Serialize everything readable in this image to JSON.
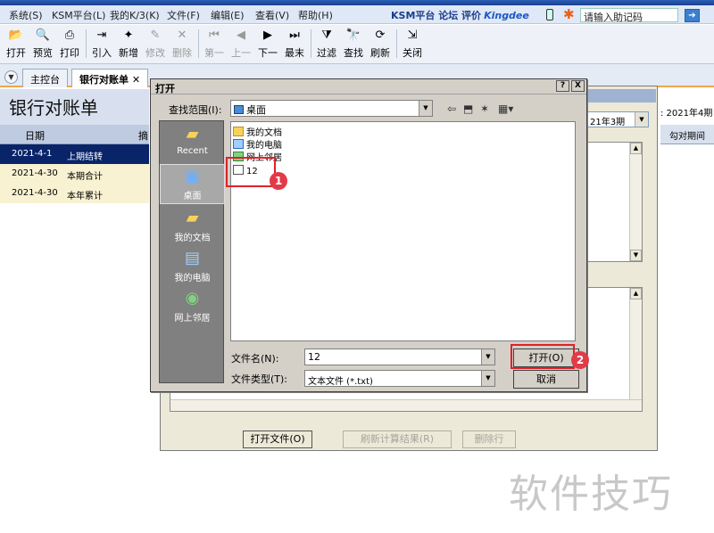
{
  "menubar": {
    "items": [
      "系统(S)",
      "KSM平台(L)",
      "我的K/3(K)",
      "文件(F)",
      "编辑(E)",
      "查看(V)",
      "帮助(H)"
    ],
    "brand": "KSM平台 论坛 评价",
    "brand_logo": "Kingdee",
    "helpcode_placeholder": "请输入助记码"
  },
  "toolbar": {
    "buttons": [
      {
        "label": "打开",
        "icon": "open-folder-icon",
        "enabled": true
      },
      {
        "label": "预览",
        "icon": "preview-icon",
        "enabled": true
      },
      {
        "label": "打印",
        "icon": "print-icon",
        "enabled": true
      },
      {
        "label": "引入",
        "icon": "import-icon",
        "enabled": true
      },
      {
        "label": "新增",
        "icon": "new-icon",
        "enabled": true
      },
      {
        "label": "修改",
        "icon": "edit-icon",
        "enabled": false
      },
      {
        "label": "删除",
        "icon": "delete-icon",
        "enabled": false
      },
      {
        "label": "第一",
        "icon": "first-icon",
        "enabled": false
      },
      {
        "label": "上一",
        "icon": "prev-icon",
        "enabled": false
      },
      {
        "label": "下一",
        "icon": "next-icon",
        "enabled": true
      },
      {
        "label": "最末",
        "icon": "last-icon",
        "enabled": true
      },
      {
        "label": "过滤",
        "icon": "filter-icon",
        "enabled": true
      },
      {
        "label": "查找",
        "icon": "find-icon",
        "enabled": true
      },
      {
        "label": "刷新",
        "icon": "refresh-icon",
        "enabled": true
      },
      {
        "label": "关闭",
        "icon": "close-door-icon",
        "enabled": true
      }
    ]
  },
  "tabs": {
    "menu_icon": "chevron-down-icon",
    "items": [
      {
        "label": "主控台",
        "active": false
      },
      {
        "label": "银行对账单",
        "active": true,
        "close": "✕"
      }
    ]
  },
  "report": {
    "title": "银行对账单",
    "col_date": "日期",
    "col_summary": "摘要",
    "rows": [
      {
        "date": "2021-4-1",
        "summary": "上期结转",
        "selected": true
      },
      {
        "date": "2021-4-30",
        "summary": "本期合计",
        "selected": false
      },
      {
        "date": "2021-4-30",
        "summary": "本年累计",
        "selected": false
      }
    ],
    "period_right": ": 2021年4期",
    "col_right": "勾对期间"
  },
  "bg_dialog": {
    "period_value": "21年3期",
    "buttons": [
      {
        "label": "打开文件(O)",
        "enabled": true
      },
      {
        "label": "刷新计算结果(R)",
        "enabled": false
      },
      {
        "label": "删除行",
        "enabled": false
      }
    ]
  },
  "open_dialog": {
    "title": "打开",
    "help_btn": "?",
    "close_btn": "X",
    "lookin_label": "查找范围(I):",
    "lookin_value": "桌面",
    "places": [
      {
        "label": "Recent",
        "icon": "recent-folder-icon",
        "selected": false
      },
      {
        "label": "桌面",
        "icon": "desktop-icon",
        "selected": true
      },
      {
        "label": "我的文档",
        "icon": "my-documents-icon",
        "selected": false
      },
      {
        "label": "我的电脑",
        "icon": "my-computer-icon",
        "selected": false
      },
      {
        "label": "网上邻居",
        "icon": "network-places-icon",
        "selected": false
      }
    ],
    "files": [
      {
        "name": "我的文档",
        "icon": "folder-icon"
      },
      {
        "name": "我的电脑",
        "icon": "computer-icon"
      },
      {
        "name": "网上邻居",
        "icon": "network-icon"
      },
      {
        "name": "12",
        "icon": "text-file-icon"
      }
    ],
    "filename_label": "文件名(N):",
    "filename_value": "12",
    "filetype_label": "文件类型(T):",
    "filetype_value": "文本文件 (*.txt)",
    "open_button": "打开(O)",
    "cancel_button": "取消"
  },
  "annotations": {
    "badge1": "1",
    "badge2": "2"
  },
  "watermark": "软件技巧",
  "colors": {
    "accent_red": "#e0202a",
    "selected_row": "#0a246a",
    "row_alt": "#f8f2d2"
  }
}
